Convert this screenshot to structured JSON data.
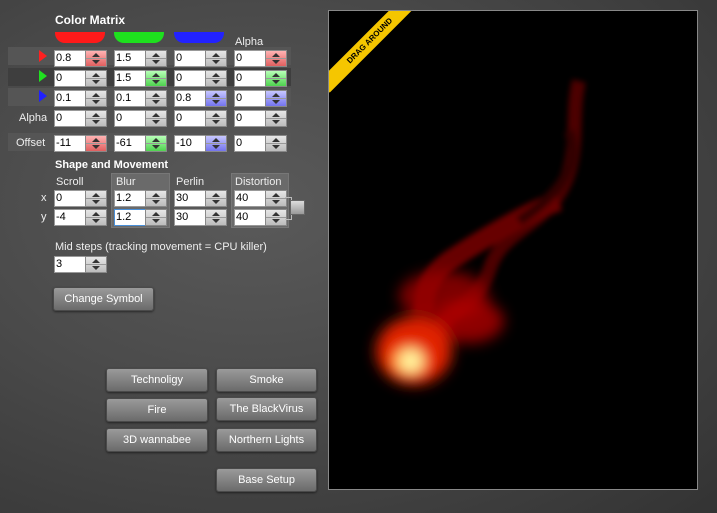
{
  "color_matrix": {
    "title": "Color Matrix",
    "alpha_header": "Alpha",
    "colors": {
      "red": "#ff2020",
      "green": "#20e020",
      "blue": "#2020ff"
    },
    "rows": [
      {
        "label": "",
        "values": [
          "0.8",
          "1.5",
          "0",
          "0"
        ]
      },
      {
        "label": "",
        "values": [
          "0",
          "1.5",
          "0",
          "0"
        ]
      },
      {
        "label": "",
        "values": [
          "0.1",
          "0.1",
          "0.8",
          "0"
        ]
      },
      {
        "label": "Alpha",
        "values": [
          "0",
          "0",
          "0",
          "0"
        ]
      },
      {
        "label": "Offset",
        "values": [
          "-11",
          "-61",
          "-10",
          "0"
        ]
      }
    ]
  },
  "shape_movement": {
    "title": "Shape and Movement",
    "columns": [
      "Scroll",
      "Blur",
      "Perlin",
      "Distortion"
    ],
    "rows": [
      {
        "label": "x",
        "values": [
          "0",
          "1.2",
          "30",
          "40"
        ]
      },
      {
        "label": "y",
        "values": [
          "-4",
          "1.2",
          "30",
          "40"
        ]
      }
    ]
  },
  "mid_steps": {
    "label": "Mid steps (tracking movement = CPU killer)",
    "value": "3"
  },
  "buttons": {
    "change_symbol": "Change Symbol",
    "technoligy": "Technoligy",
    "smoke": "Smoke",
    "fire": "Fire",
    "black_virus": "The BlackVirus",
    "wannabee": "3D wannabee",
    "northern_lights": "Northern Lights",
    "base_setup": "Base Setup"
  },
  "preview": {
    "ribbon": "DRAG AROUND"
  }
}
